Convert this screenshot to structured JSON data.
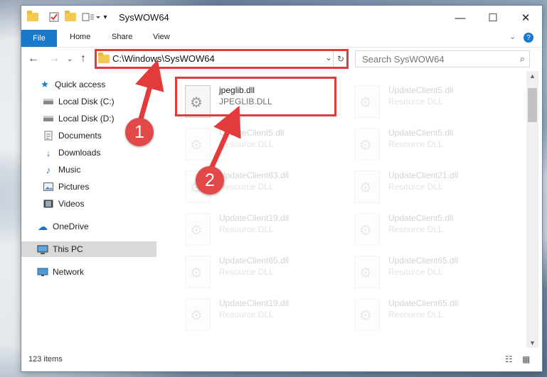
{
  "window": {
    "title": "SysWOW64"
  },
  "ribbon": {
    "tabs": [
      "File",
      "Home",
      "Share",
      "View"
    ]
  },
  "address": {
    "path": "C:\\Windows\\SysWOW64"
  },
  "search": {
    "placeholder": "Search SysWOW64"
  },
  "sidebar": {
    "quick_access": "Quick access",
    "items": [
      {
        "label": "Local Disk (C:)",
        "icon": "drive-icon"
      },
      {
        "label": "Local Disk (D:)",
        "icon": "drive-icon"
      },
      {
        "label": "Documents",
        "icon": "documents-icon"
      },
      {
        "label": "Downloads",
        "icon": "download-icon"
      },
      {
        "label": "Music",
        "icon": "music-icon"
      },
      {
        "label": "Pictures",
        "icon": "pictures-icon"
      },
      {
        "label": "Videos",
        "icon": "videos-icon"
      }
    ],
    "onedrive": "OneDrive",
    "this_pc": "This PC",
    "network": "Network"
  },
  "files": {
    "highlighted": {
      "name": "jpeglib.dll",
      "type": "JPEGLIB.DLL"
    },
    "faded": [
      {
        "name": "UpdateClient5.dll",
        "type": "Resource DLL"
      },
      {
        "name": "UpdateClient5.dll",
        "type": "Resource DLL"
      },
      {
        "name": "UpdateClient5.dll",
        "type": "Resource DLL"
      },
      {
        "name": "UpdateClient63.dll",
        "type": "Resource DLL"
      },
      {
        "name": "UpdateClient21.dll",
        "type": "Resource DLL"
      },
      {
        "name": "UpdateClient19.dll",
        "type": "Resource DLL"
      },
      {
        "name": "UpdateClient5.dll",
        "type": "Resource DLL"
      },
      {
        "name": "UpdateClient65.dll",
        "type": "Resource DLL"
      },
      {
        "name": "UpdateClient65.dll",
        "type": "Resource DLL"
      },
      {
        "name": "UpdateClient19.dll",
        "type": "Resource DLL"
      },
      {
        "name": "UpdateClient65.dll",
        "type": "Resource DLL"
      }
    ]
  },
  "status": {
    "item_count": "123 items"
  },
  "annotations": {
    "step1": "1",
    "step2": "2",
    "color": "#e33b3b"
  }
}
